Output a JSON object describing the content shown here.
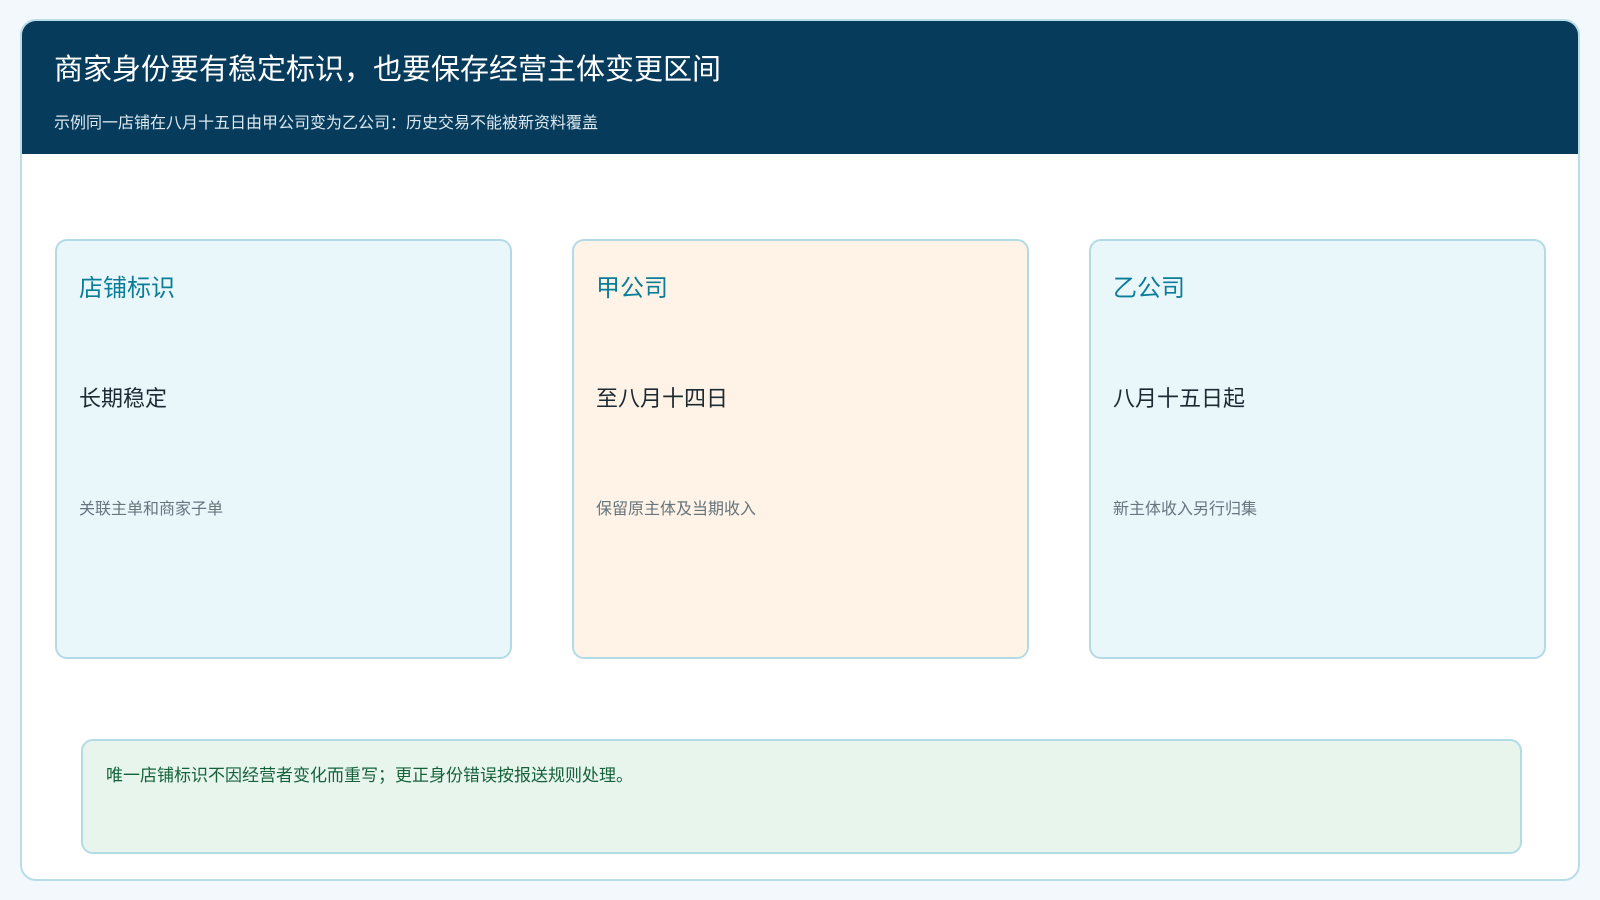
{
  "header": {
    "title": "商家身份要有稳定标识，也要保存经营主体变更区间",
    "subtitle": "示例同一店铺在八月十五日由甲公司变为乙公司：历史交易不能被新资料覆盖"
  },
  "cards": [
    {
      "label": "店铺标识",
      "value": "长期稳定",
      "note": "关联主单和商家子单",
      "background": "#e9f7fb"
    },
    {
      "label": "甲公司",
      "value": "至八月十四日",
      "note": "保留原主体及当期收入",
      "background": "#fef3e6"
    },
    {
      "label": "乙公司",
      "value": "八月十五日起",
      "note": "新主体收入另行归集",
      "background": "#e9f7fb"
    }
  ],
  "footer": {
    "text": "唯一店铺标识不因经营者变化而重写；更正身份错误按报送规则处理。"
  },
  "colors": {
    "header_bg": "#073b5c",
    "accent": "#0b7d99",
    "border": "#b3dbe6",
    "footer_bg": "#e7f5ed",
    "footer_text": "#15623a"
  }
}
